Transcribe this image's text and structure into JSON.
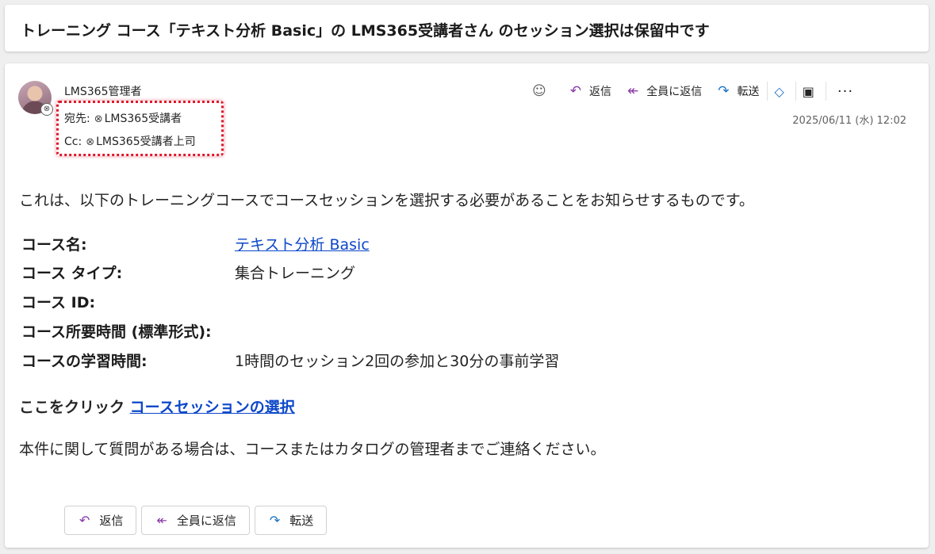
{
  "subject": "トレーニング コース「テキスト分析 Basic」の LMS365受講者さん のセッション選択は保留中です",
  "sender": {
    "name": "LMS365管理者",
    "to_label": "宛先:",
    "to": "LMS365受講者",
    "cc_label": "Cc:",
    "cc": "LMS365受講者上司",
    "date": "2025/06/11 (水) 12:02"
  },
  "toolbar": {
    "reply": "返信",
    "reply_all": "全員に返信",
    "forward": "転送",
    "more": "···"
  },
  "body": {
    "intro": "これは、以下のトレーニングコースでコースセッションを選択する必要があることをお知らせするものです。",
    "details": [
      {
        "key": "コース名:",
        "value": "テキスト分析 Basic"
      },
      {
        "key": "コース タイプ:",
        "value": "集合トレーニング"
      },
      {
        "key": "コース ID:",
        "value": ""
      },
      {
        "key": "コース所要時間 (標準形式):",
        "value": ""
      },
      {
        "key": "コースの学習時間:",
        "value": "1時間のセッション2回の参加と30分の事前学習"
      }
    ],
    "click_prefix": "ここをクリック",
    "click_link": "コースセッションの選択",
    "closing": "本件に関して質問がある場合は、コースまたはカタログの管理者までご連絡ください。"
  },
  "actions": {
    "reply": "返信",
    "reply_all": "全員に返信",
    "forward": "転送"
  },
  "colors": {
    "link": "#0d47c9",
    "highlight": "#e0162b",
    "reply_icon": "#8a3aa8",
    "forward_icon": "#1a73c5"
  }
}
